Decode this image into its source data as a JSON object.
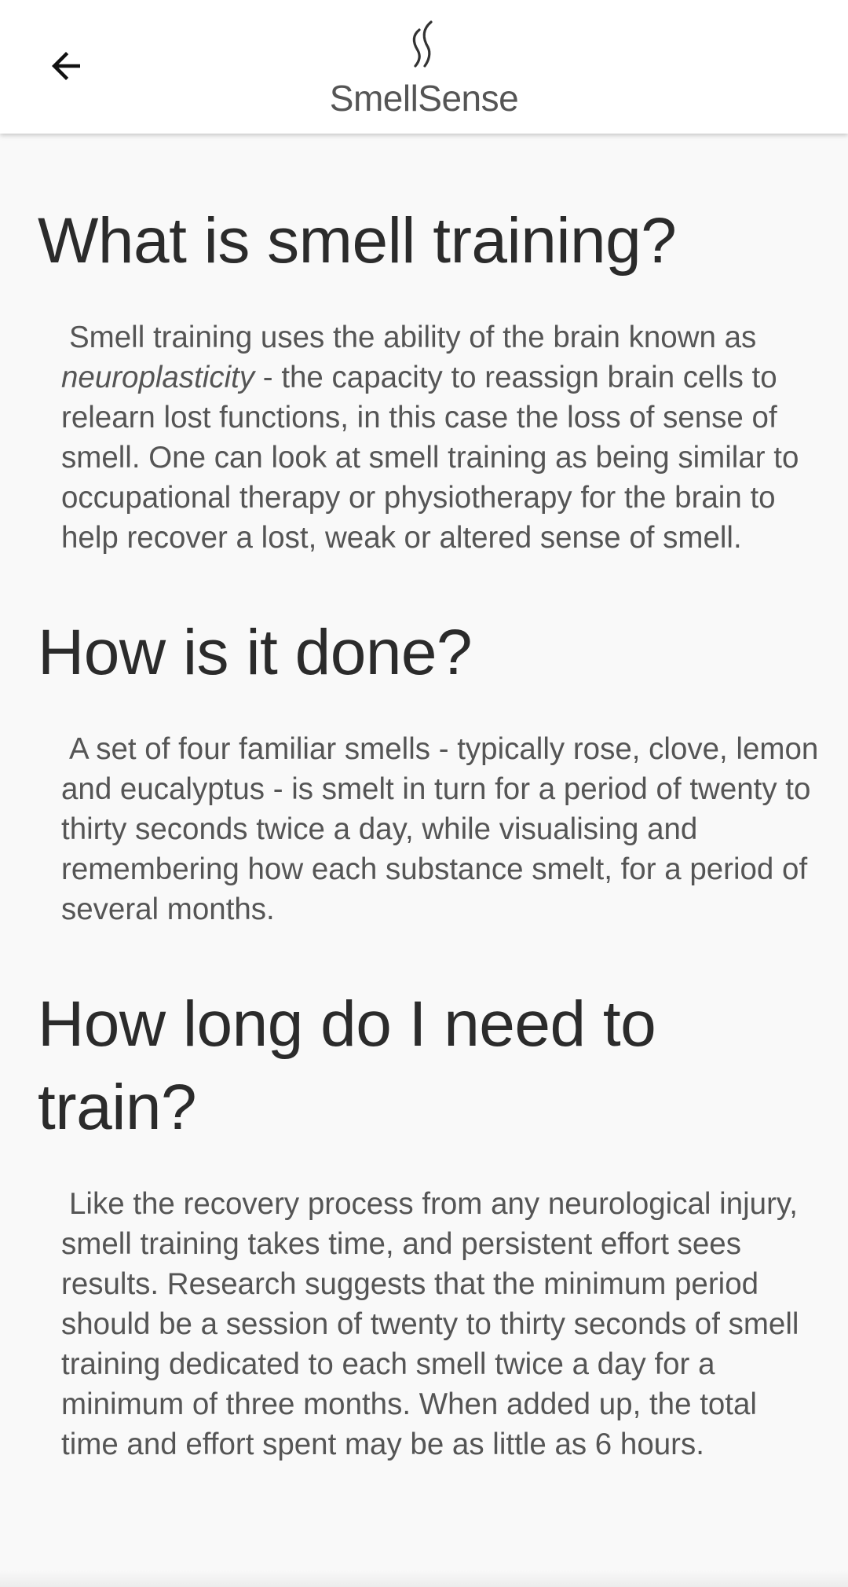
{
  "header": {
    "title": "SmellSense",
    "back_icon": "arrow-left-icon",
    "logo_icon": "scent-wisp-icon"
  },
  "sections": [
    {
      "heading": "What is smell training?",
      "body_start": "Smell training uses the ability of the brain known as ",
      "body_emphasis": "neuroplasticity",
      "body_end": " - the capacity to reassign brain cells to relearn lost functions, in this case the loss of sense of smell. One can look at smell training as being similar to occupational therapy or physiotherapy for the brain to help recover a lost, weak or altered sense of smell."
    },
    {
      "heading": "How is it done?",
      "body": "A set of four familiar smells - typically rose, clove, lemon and eucalyptus - is smelt in turn for a period of twenty to thirty seconds twice a day, while visualising and remembering how each substance smelt, for a period of several months."
    },
    {
      "heading": "How long do I need to train?",
      "body": "Like the recovery process from any neurological injury, smell training takes time, and persistent effort sees results. Research suggests that the minimum period should be a session of twenty to thirty seconds of smell training dedicated to each smell twice a day for a minimum of three months. When added up, the total time and effort spent may be as little as 6 hours."
    }
  ],
  "colors": {
    "background": "#f9f9f9",
    "app_bar": "#ffffff",
    "heading_text": "#2b2b2b",
    "body_text": "#555555"
  }
}
